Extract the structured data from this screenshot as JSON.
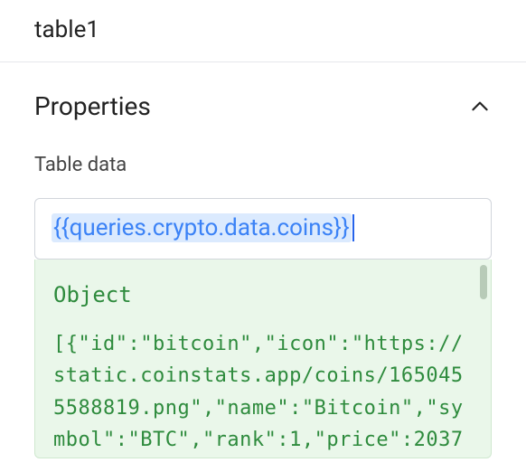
{
  "header": {
    "title": "table1"
  },
  "section": {
    "title": "Properties"
  },
  "field": {
    "label": "Table data",
    "expression": "{{queries.crypto.data.coins}}"
  },
  "preview": {
    "type_label": "Object",
    "body": "[{\"id\":\"bitcoin\",\"icon\":\"https://static.coinstats.app/coins/1650455588819.png\",\"name\":\"Bitcoin\",\"symbol\":\"BTC\",\"rank\":1,\"price\":2037"
  }
}
